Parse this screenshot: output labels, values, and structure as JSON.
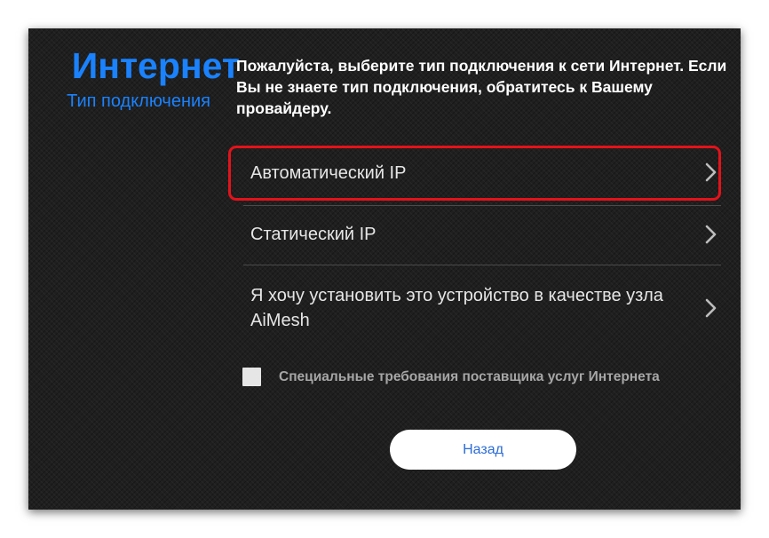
{
  "header": {
    "title": "Интернет",
    "subtitle": "Тип подключения"
  },
  "instruction": "Пожалуйста, выберите тип подключения к сети Интернет. Если Вы не знаете тип подключения, обратитесь к Вашему провайдеру.",
  "options": [
    {
      "label": "Автоматический IP",
      "icon": "chevron-right-icon",
      "highlighted": true
    },
    {
      "label": "Статический IP",
      "icon": "chevron-right-icon",
      "highlighted": false
    },
    {
      "label": "Я хочу установить это устройство в качестве узла AiMesh",
      "icon": "chevron-right-icon",
      "highlighted": false
    }
  ],
  "special_requirements": {
    "label": "Специальные требования поставщика услуг Интернета",
    "checked": false
  },
  "back_button": {
    "label": "Назад"
  },
  "colors": {
    "accent": "#1a82ff",
    "highlight": "#e4121a",
    "background": "#1f1f1f",
    "button_text": "#2c6cd6"
  }
}
